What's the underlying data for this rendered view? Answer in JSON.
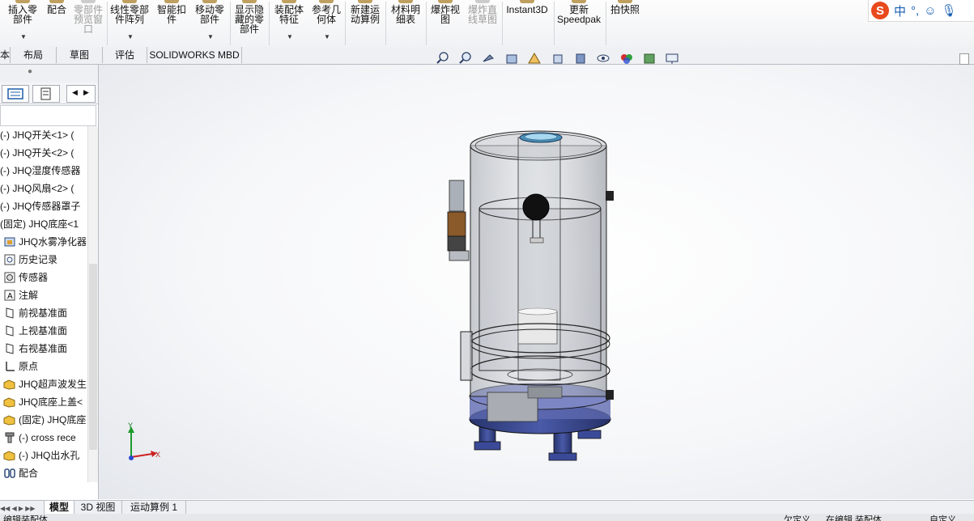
{
  "ribbon": {
    "buttons": [
      {
        "label": "插入零\n部件",
        "disabled": false
      },
      {
        "label": "配合",
        "disabled": false
      },
      {
        "label": "零部件\n预览窗\n口",
        "disabled": true
      },
      {
        "label": "线性零部\n件阵列",
        "disabled": false
      },
      {
        "label": "智能扣\n件",
        "disabled": false
      },
      {
        "label": "移动零\n部件",
        "disabled": false
      },
      {
        "label": "显示隐\n藏的零\n部件",
        "disabled": false
      },
      {
        "label": "装配体\n特征",
        "disabled": false
      },
      {
        "label": "参考几\n何体",
        "disabled": false
      },
      {
        "label": "新建运\n动算例",
        "disabled": false
      },
      {
        "label": "材料明\n细表",
        "disabled": false
      },
      {
        "label": "爆炸视\n图",
        "disabled": false
      },
      {
        "label": "爆炸直\n线草图",
        "disabled": true
      },
      {
        "label": "Instant3D",
        "disabled": false
      },
      {
        "label": "更新\nSpeedpak",
        "disabled": false
      },
      {
        "label": "拍快照",
        "disabled": false
      }
    ]
  },
  "ime": {
    "logo": "S",
    "mode": "中",
    "punct": "°,"
  },
  "cmd_tabs": [
    "布局",
    "草图",
    "评估",
    "SOLIDWORKS MBD"
  ],
  "tree": [
    {
      "label": "(-) JHQ开关<1> (",
      "icon": "part-icon"
    },
    {
      "label": "(-) JHQ开关<2> (",
      "icon": "part-icon"
    },
    {
      "label": "(-) JHQ湿度传感器",
      "icon": "part-icon"
    },
    {
      "label": "(-) JHQ风扇<2> (",
      "icon": "part-icon"
    },
    {
      "label": "(-) JHQ传感器罩子",
      "icon": "part-icon"
    },
    {
      "label": "(固定) JHQ底座<1",
      "icon": "part-icon"
    },
    {
      "label": "JHQ水雾净化器",
      "icon": "assembly-icon"
    },
    {
      "label": "历史记录",
      "icon": "history-icon"
    },
    {
      "label": "传感器",
      "icon": "sensor-icon"
    },
    {
      "label": "注解",
      "icon": "annotation-icon"
    },
    {
      "label": "前视基准面",
      "icon": "plane-icon"
    },
    {
      "label": "上视基准面",
      "icon": "plane-icon"
    },
    {
      "label": "右视基准面",
      "icon": "plane-icon"
    },
    {
      "label": "原点",
      "icon": "origin-icon"
    },
    {
      "label": "JHQ超声波发生",
      "icon": "subassembly-icon"
    },
    {
      "label": "JHQ底座上盖<",
      "icon": "subassembly-icon"
    },
    {
      "label": "(固定) JHQ底座",
      "icon": "subassembly-icon"
    },
    {
      "label": "(-) cross rece",
      "icon": "screw-icon"
    },
    {
      "label": "(-) JHQ出水孔",
      "icon": "subassembly-icon"
    },
    {
      "label": "配合",
      "icon": "mates-icon"
    }
  ],
  "axes": {
    "y": "Y",
    "x": "X"
  },
  "bottom_tabs": [
    "模型",
    "3D 视图",
    "运动算例 1"
  ],
  "status": {
    "left": "编辑装配体",
    "mid1": "欠定义",
    "mid2": "在编辑 装配体",
    "right": "自定义"
  },
  "colors": {
    "accent": "#1a5fb4",
    "ime_logo": "#e8491d",
    "background_top": "#ffffff",
    "background_edge": "#e4e7ec"
  }
}
